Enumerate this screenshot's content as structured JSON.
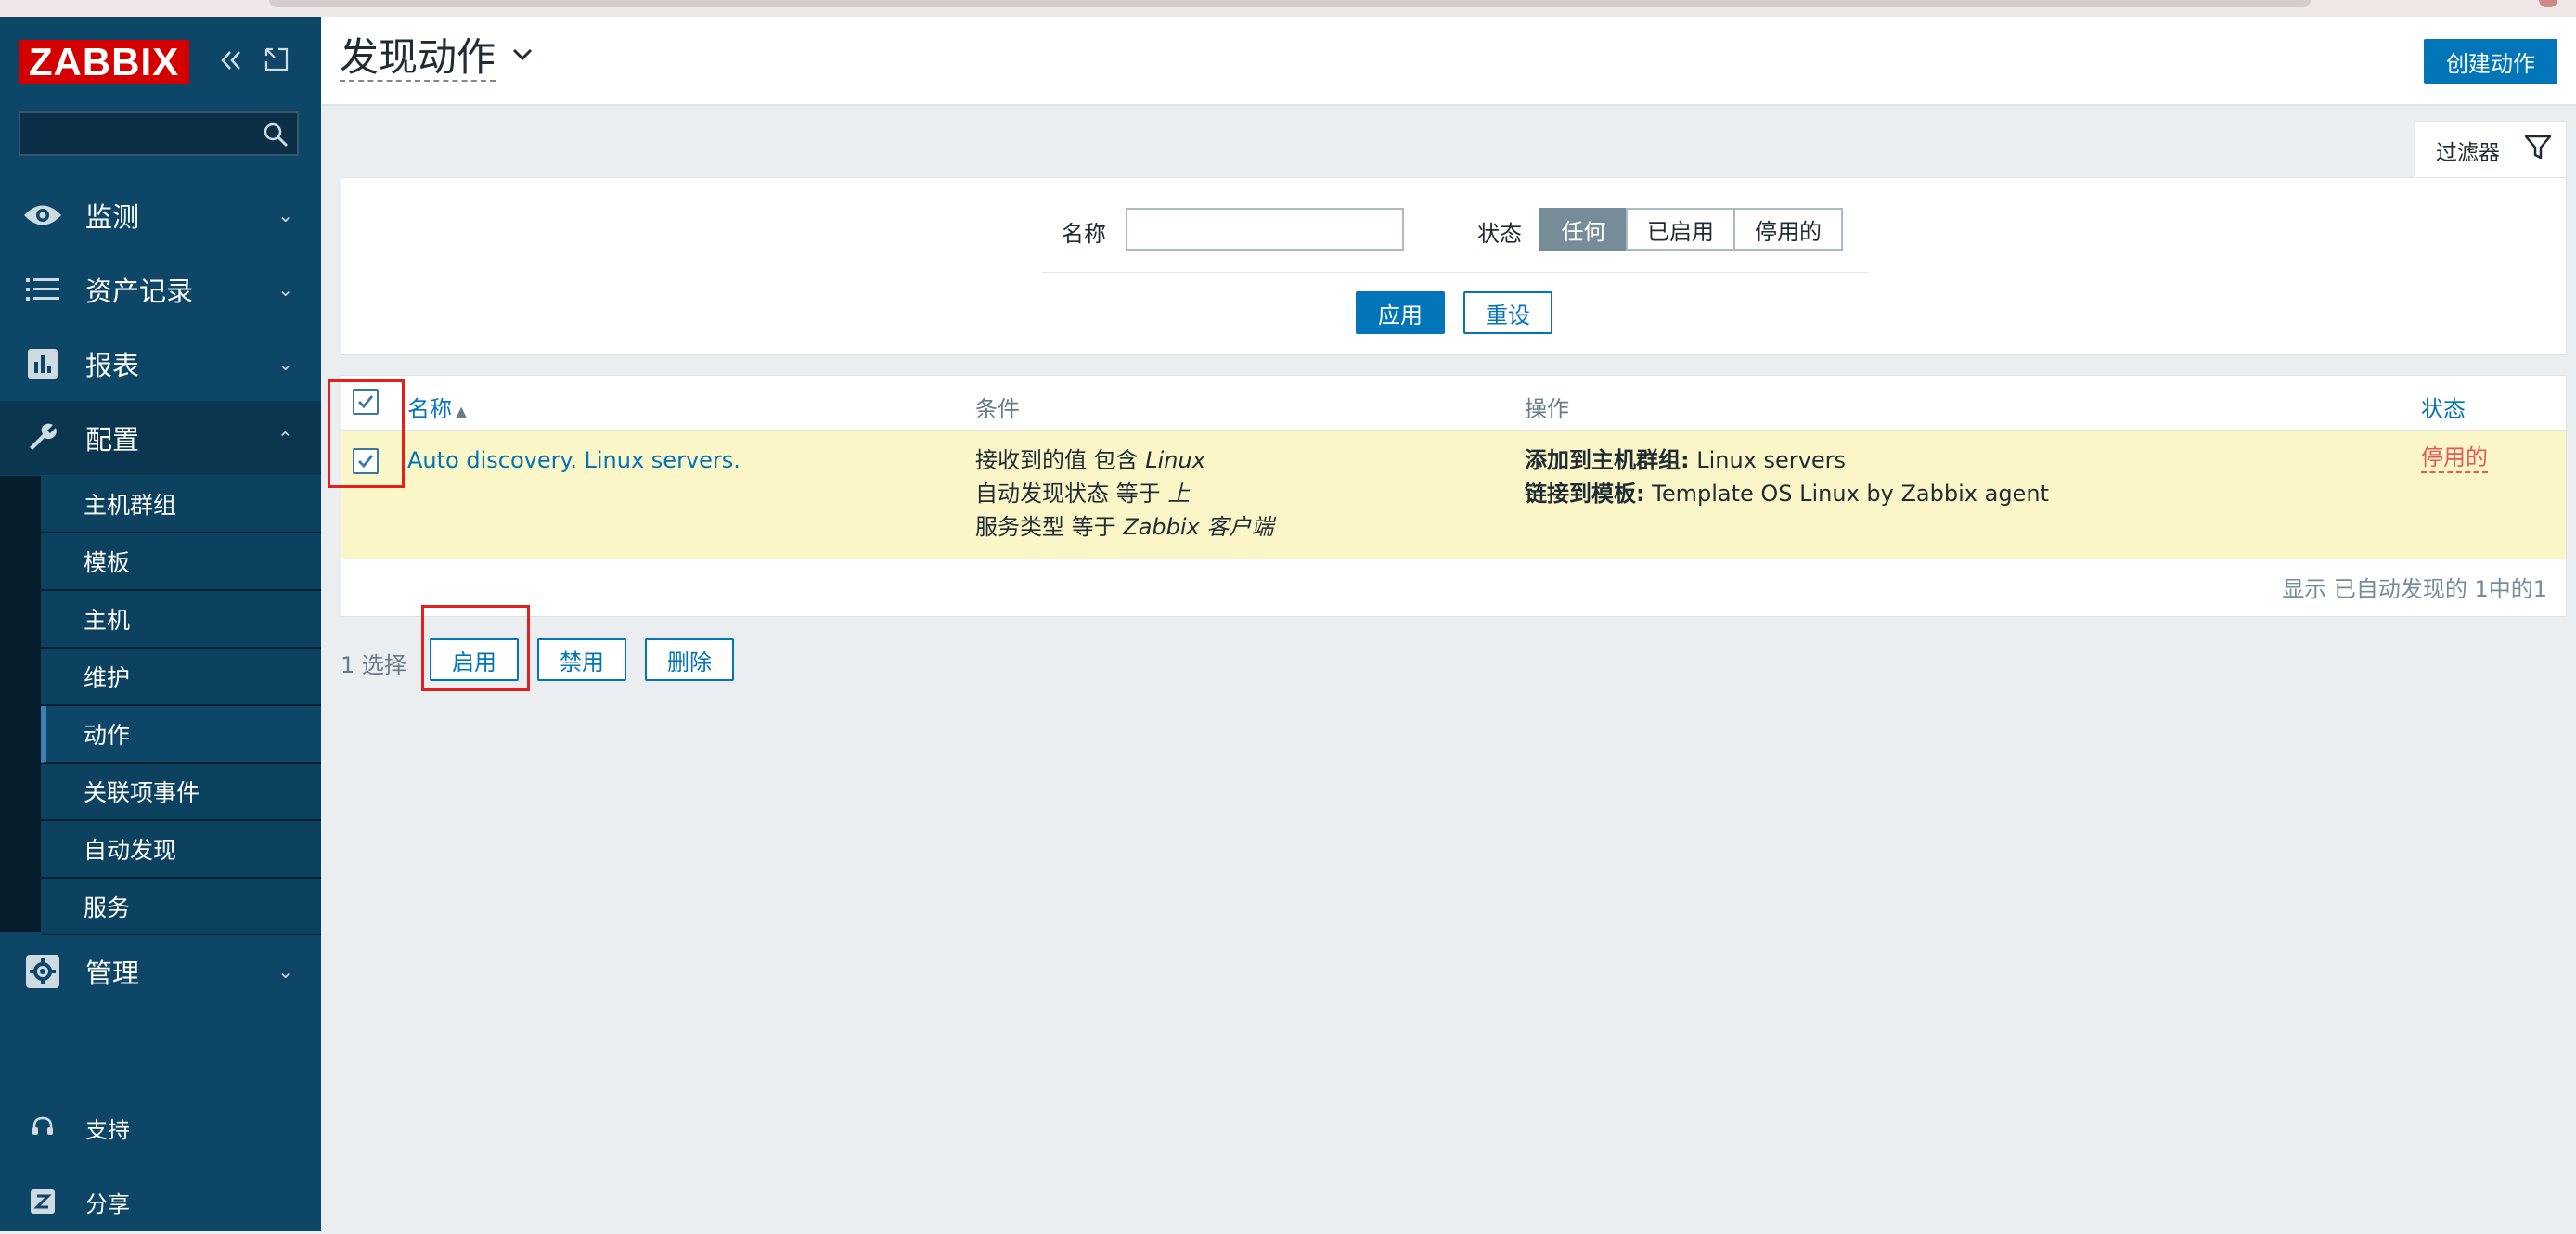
{
  "app": {
    "logo": "ZABBIX"
  },
  "sidebar": {
    "search_placeholder": "",
    "nav": [
      {
        "label": "监测",
        "icon": "eye-icon"
      },
      {
        "label": "资产记录",
        "icon": "list-icon"
      },
      {
        "label": "报表",
        "icon": "bar-chart-icon"
      },
      {
        "label": "配置",
        "icon": "wrench-icon"
      },
      {
        "label": "管理",
        "icon": "gear-icon"
      }
    ],
    "config_items": [
      "主机群组",
      "模板",
      "主机",
      "维护",
      "动作",
      "关联项事件",
      "自动发现",
      "服务"
    ],
    "current_item": "动作",
    "bottom": [
      {
        "label": "支持",
        "icon": "headset-icon"
      },
      {
        "label": "分享",
        "icon": "share-z-icon"
      }
    ]
  },
  "header": {
    "title": "发现动作",
    "create_button": "创建动作"
  },
  "filter": {
    "tab_label": "过滤器",
    "name_label": "名称",
    "name_value": "",
    "status_label": "状态",
    "status_options": [
      "任何",
      "已启用",
      "停用的"
    ],
    "status_selected": "任何",
    "apply": "应用",
    "reset": "重设"
  },
  "table": {
    "columns": {
      "name": "名称",
      "conditions": "条件",
      "operations": "操作",
      "status": "状态"
    },
    "sort_indicator": "▲",
    "rows": [
      {
        "name": "Auto discovery. Linux servers.",
        "conditions": [
          {
            "text": "接收到的值 包含 ",
            "value": "Linux"
          },
          {
            "text": "自动发现状态 等于 ",
            "value": "上"
          },
          {
            "text": "服务类型 等于 ",
            "value": "Zabbix 客户端"
          }
        ],
        "operations": [
          {
            "label": "添加到主机群组:",
            "value": " Linux servers"
          },
          {
            "label": "链接到模板:",
            "value": " Template OS Linux by Zabbix agent"
          }
        ],
        "status": "停用的",
        "checked": true
      }
    ],
    "footer": "显示 已自动发现的 1中的1"
  },
  "mass_actions": {
    "selected": "1 选择",
    "enable": "启用",
    "disable": "禁用",
    "delete": "删除"
  },
  "colors": {
    "sidebar_bg": "#0e4667",
    "primary": "#0275b8",
    "row_highlight": "#fbf6c7",
    "disabled_status": "#e45959",
    "highlight_box": "#e3201e"
  }
}
